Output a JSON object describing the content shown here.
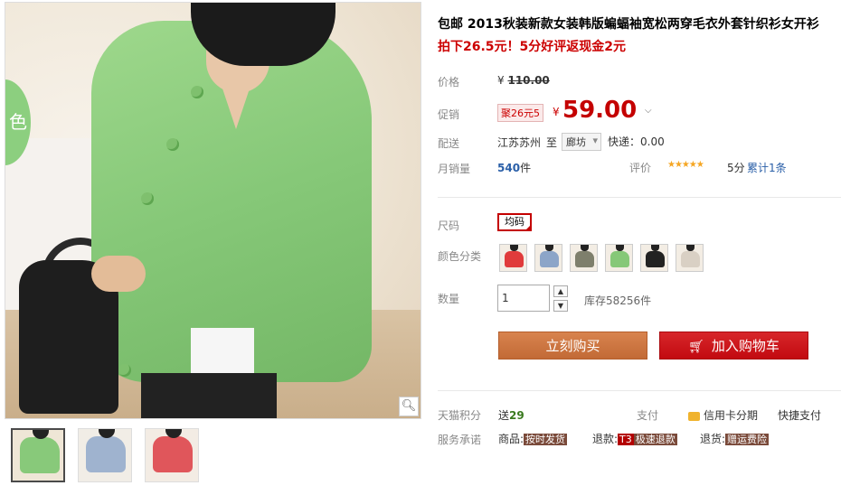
{
  "gallery": {
    "color_badge": "色",
    "zoom_icon": "magnifier-icon",
    "thumbnails": [
      {
        "color": "#88c97a",
        "active": true
      },
      {
        "color": "#9fb3cf",
        "active": false
      },
      {
        "color": "#e0565b",
        "active": false
      }
    ]
  },
  "product": {
    "title": "包邮 2013秋装新款女装韩版蝙蝠袖宽松两穿毛衣外套针织衫女开衫",
    "promo": "拍下26.5元！5分好评返现金2元"
  },
  "price": {
    "label": "价格",
    "currency": "¥",
    "original": "110.00",
    "promo_label": "促销",
    "promo_tag": "聚26元5",
    "current": "59.00",
    "expand_icon": "chevron-down-icon"
  },
  "shipping": {
    "label": "配送",
    "from": "江苏苏州",
    "to_word": "至",
    "destination": "廊坊",
    "fee": "快递：0.00"
  },
  "sales": {
    "label": "月销量",
    "count": "540",
    "unit": "件",
    "rating_label": "评价",
    "stars": "★★★★★",
    "score": "5分",
    "reviews": "累计1条"
  },
  "size": {
    "label": "尺码",
    "option": "均码"
  },
  "colors": {
    "label": "颜色分类",
    "swatches": [
      "#e03b3b",
      "#8ca5c8",
      "#7e7f6c",
      "#86c878",
      "#222222",
      "#d9d0c4"
    ]
  },
  "quantity": {
    "label": "数量",
    "value": "1",
    "stock": "库存58256件"
  },
  "actions": {
    "buy_now": "立刻购买",
    "add_to_cart": "加入购物车"
  },
  "points": {
    "label": "天猫积分",
    "value_prefix": "送",
    "value": "29",
    "pay_label": "支付",
    "card_installment": "信用卡分期",
    "quick_pay": "快捷支付"
  },
  "services": {
    "label": "服务承诺",
    "goods_label": "商品:",
    "goods_tag": "按时发货",
    "refund_label": "退款:",
    "refund_badge": "T3",
    "refund_tag": "极速退款",
    "return_label": "退货:",
    "return_tag": "赠运费险"
  }
}
